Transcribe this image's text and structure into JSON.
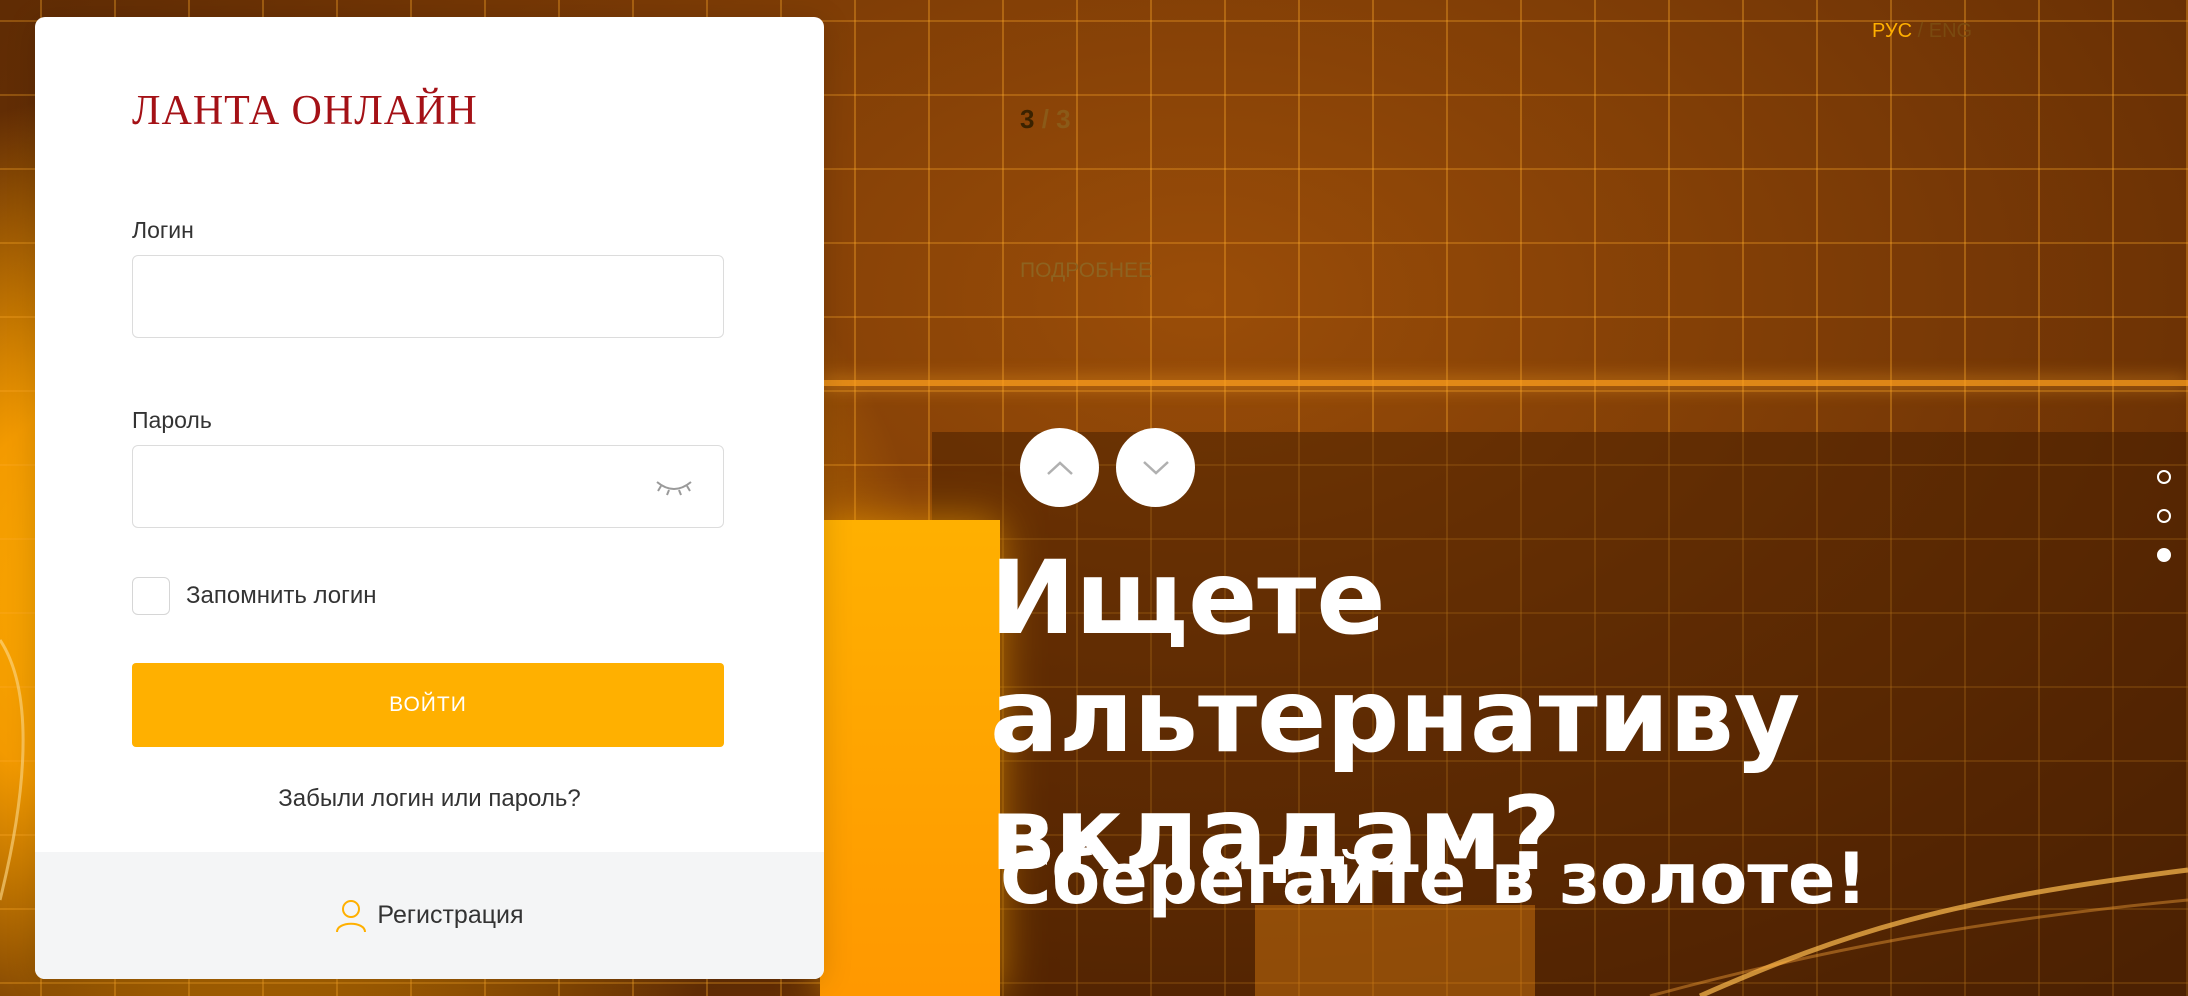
{
  "login_card": {
    "logo": "ЛАНТА ОНЛАЙН",
    "login_label": "Логин",
    "login_value": "",
    "password_label": "Пароль",
    "password_value": "",
    "remember_label": "Запомнить логин",
    "remember_checked": false,
    "login_button": "ВОЙТИ",
    "forgot_link": "Забыли логин или пароль?",
    "register_link": "Регистрация"
  },
  "language": {
    "ru": "РУС",
    "separator": "/",
    "en": "ENG",
    "active": "РУС"
  },
  "slider": {
    "current": "3",
    "separator": "/",
    "total": "3",
    "more_link": "ПОДРОБНЕЕ",
    "headline": "Ищете альтернативу вкладам?",
    "subline": "Сберегайте в золоте!",
    "active_dot": 3
  },
  "colors": {
    "accent": "#ffb000",
    "logo": "#a41116",
    "card_footer": "#f4f5f6"
  },
  "icons": {
    "password_toggle": "eye-closed-icon",
    "register": "user-icon",
    "prev": "chevron-up-icon",
    "next": "chevron-down-icon"
  }
}
